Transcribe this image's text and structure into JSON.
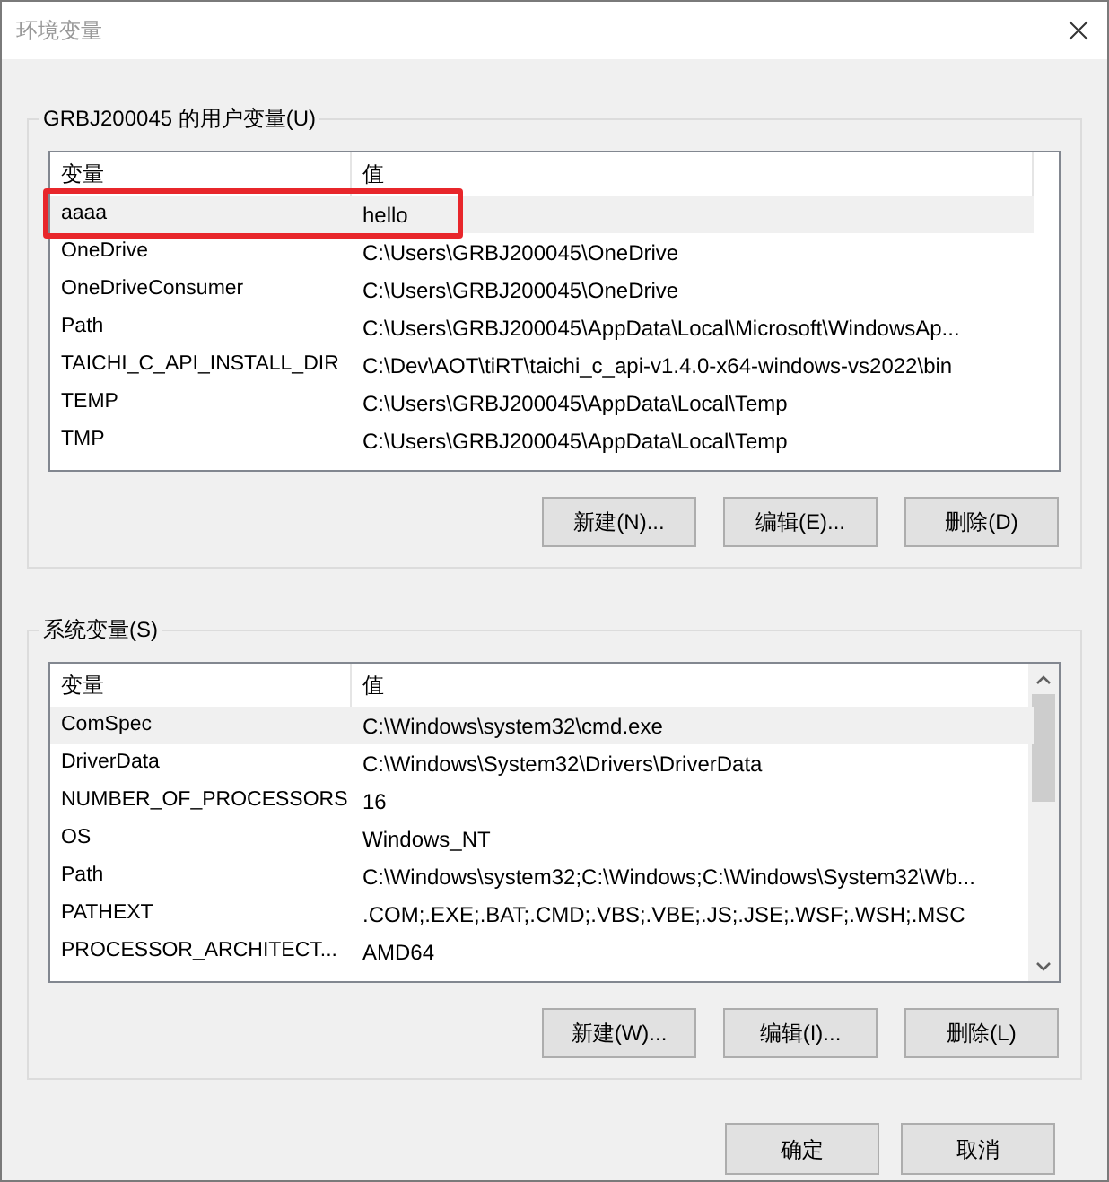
{
  "window": {
    "title": "环境变量"
  },
  "user_variables": {
    "title": "GRBJ200045 的用户变量(U)",
    "columns": [
      "变量",
      "值"
    ],
    "rows": [
      {
        "name": "aaaa",
        "value": "hello",
        "selected": true,
        "annotated": true
      },
      {
        "name": "OneDrive",
        "value": "C:\\Users\\GRBJ200045\\OneDrive",
        "selected": false,
        "annotated": false
      },
      {
        "name": "OneDriveConsumer",
        "value": "C:\\Users\\GRBJ200045\\OneDrive",
        "selected": false,
        "annotated": false
      },
      {
        "name": "Path",
        "value": "C:\\Users\\GRBJ200045\\AppData\\Local\\Microsoft\\WindowsAp...",
        "selected": false,
        "annotated": false
      },
      {
        "name": "TAICHI_C_API_INSTALL_DIR",
        "value": "C:\\Dev\\AOT\\tiRT\\taichi_c_api-v1.4.0-x64-windows-vs2022\\bin",
        "selected": false,
        "annotated": false
      },
      {
        "name": "TEMP",
        "value": "C:\\Users\\GRBJ200045\\AppData\\Local\\Temp",
        "selected": false,
        "annotated": false
      },
      {
        "name": "TMP",
        "value": "C:\\Users\\GRBJ200045\\AppData\\Local\\Temp",
        "selected": false,
        "annotated": false
      }
    ],
    "buttons": [
      "新建(N)...",
      "编辑(E)...",
      "删除(D)"
    ]
  },
  "system_variables": {
    "title": "系统变量(S)",
    "columns": [
      "变量",
      "值"
    ],
    "rows": [
      {
        "name": "ComSpec",
        "value": "C:\\Windows\\system32\\cmd.exe",
        "selected": true,
        "annotated": false
      },
      {
        "name": "DriverData",
        "value": "C:\\Windows\\System32\\Drivers\\DriverData",
        "selected": false,
        "annotated": false
      },
      {
        "name": "NUMBER_OF_PROCESSORS",
        "value": "16",
        "selected": false,
        "annotated": false
      },
      {
        "name": "OS",
        "value": "Windows_NT",
        "selected": false,
        "annotated": false
      },
      {
        "name": "Path",
        "value": "C:\\Windows\\system32;C:\\Windows;C:\\Windows\\System32\\Wb...",
        "selected": false,
        "annotated": false
      },
      {
        "name": "PATHEXT",
        "value": ".COM;.EXE;.BAT;.CMD;.VBS;.VBE;.JS;.JSE;.WSF;.WSH;.MSC",
        "selected": false,
        "annotated": false
      },
      {
        "name": "PROCESSOR_ARCHITECT...",
        "value": "AMD64",
        "selected": false,
        "annotated": false
      }
    ],
    "buttons": [
      "新建(W)...",
      "编辑(I)...",
      "删除(L)"
    ]
  },
  "dialog_buttons": [
    "确定",
    "取消"
  ]
}
